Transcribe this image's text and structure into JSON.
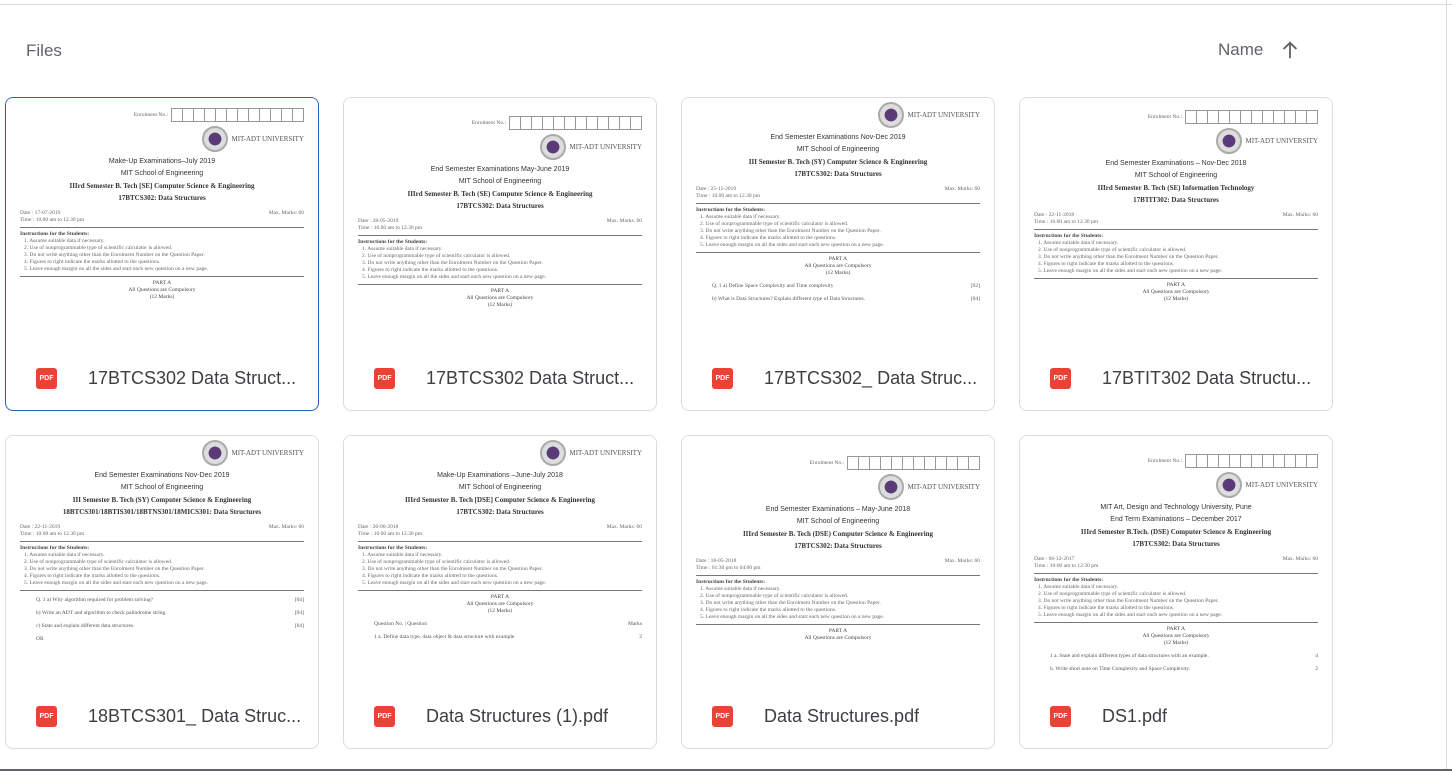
{
  "header": {
    "title": "Files",
    "sort_label": "Name",
    "sort_direction": "ascending"
  },
  "colors": {
    "pdf_icon": "#ea4335",
    "selected_border": "#2a62b8"
  },
  "instructions_title": "Instructions for the Students:",
  "instructions": [
    "1. Assume suitable data if necessary.",
    "2. Use of nonprogrammable type of scientific calculator is allowed.",
    "3. Do not write anything other than the Enrolment Number on the Question Paper.",
    "4. Figures to right indicate the marks allotted to the questions.",
    "5. Leave enough margin on all the sides and start each new question on a new page."
  ],
  "logo_text": "MIT-ADT UNIVERSITY",
  "enrolment_label": "Enrolment No.:",
  "files": [
    {
      "name": "17BTCS302 Data Structures",
      "display": "17BTCS302 Data Struct...",
      "icon": "PDF",
      "selected": true,
      "enrol": true,
      "headings": [
        "Make-Up Examinations–July 2019",
        "MIT School of Engineering",
        "IIIrd Semester B. Tech [SE] Computer Science & Engineering",
        "17BTCS302: Data Structures"
      ],
      "date": "Date : 17-07-2019",
      "time": "Time : 10.00 am to 12.30 pm",
      "marks": "Max. Marks: 60",
      "body": [
        "PART A",
        "All Questions are Compulsory",
        "(12 Marks)"
      ],
      "questions": []
    },
    {
      "name": "17BTCS302 Data Structures",
      "display": "17BTCS302 Data Struct...",
      "icon": "PDF",
      "selected": false,
      "enrol": true,
      "headings": [
        "End Semester Examinations May-June 2019",
        "MIT School of Engineering",
        "IIIrd Semester B. Tech (SE) Computer Science & Engineering",
        "17BTCS302: Data Structures"
      ],
      "date": "Date : 28-05-2019",
      "time": "Time : 10.00 am to 12.30 pm",
      "marks": "Max. Marks: 60",
      "body": [
        "PART A",
        "All Questions are Compulsory",
        "(12 Marks)"
      ],
      "questions": []
    },
    {
      "name": "17BTCS302_ Data Structures",
      "display": "17BTCS302_ Data Struc...",
      "icon": "PDF",
      "selected": false,
      "enrol": false,
      "headings": [
        "End Semester Examinations Nov-Dec 2019",
        "MIT School of Engineering",
        "III Semester B. Tech (SY) Computer Science & Engineering",
        "17BTCS302: Data Structures"
      ],
      "date": "Date : 25-11-2019",
      "time": "Time : 10.00 am to 12.30 pm",
      "marks": "Max. Marks: 60",
      "body": [
        "PART A",
        "All Questions are Compulsory",
        "(12 Marks)"
      ],
      "questions": [
        {
          "q": "Q. 1   a) Define Space Complexity and Time complexity",
          "m": "[02]"
        },
        {
          "q": "b) What is Data Structures? Explain different type of Data Structures.",
          "m": "[04]"
        }
      ]
    },
    {
      "name": "17BTIT302 Data Structures",
      "display": "17BTIT302 Data Structu...",
      "icon": "PDF",
      "selected": false,
      "enrol": true,
      "headings": [
        "End Semester Examinations – Nov-Dec 2018",
        "MIT School of Engineering",
        "IIIrd Semester B. Tech (SE) Information Technology",
        "17BTIT302: Data Structures"
      ],
      "date": "Date : 22-11-2018",
      "time": "Time : 10.00 am to 12.30 pm",
      "marks": "Max. Marks: 60",
      "body": [
        "PART A",
        "All Questions are Compulsory",
        "(12 Marks)"
      ],
      "questions": []
    },
    {
      "name": "18BTCS301_ Data Structures",
      "display": "18BTCS301_ Data Struc...",
      "icon": "PDF",
      "selected": false,
      "enrol": false,
      "headings": [
        "End Semester Examinations Nov-Dec 2019",
        "MIT School of Engineering",
        "III Semester B. Tech (SY) Computer Science & Engineering",
        "18BTCS301/18BTIS301/18BTNS301/18MICS301: Data Structures"
      ],
      "date": "Date : 22-11-2019",
      "time": "Time : 10:00 am to 12.30 pm",
      "marks": "Max. Marks: 60",
      "body": [],
      "questions": [
        {
          "q": "Q. 1   a) Why algorithm required for problem solving?",
          "m": "[04]"
        },
        {
          "q": "b) Write an ADT and algorithm to check palindrome string.",
          "m": "[04]"
        },
        {
          "q": "c) State and explain different data structures.",
          "m": "[04]"
        },
        {
          "q": "OR",
          "m": ""
        }
      ]
    },
    {
      "name": "Data Structures (1).pdf",
      "display": "Data Structures (1).pdf",
      "icon": "PDF",
      "selected": false,
      "enrol": false,
      "headings": [
        "Make-Up Examinations –June-July 2018",
        "MIT School of Engineering",
        "IIIrd Semester B. Tech [DSE] Computer Science & Engineering",
        "17BTCS302: Data Structures"
      ],
      "date": "Date : 26-06-2018",
      "time": "Time : 10.00 am to 12.30 pm",
      "marks": "Max. Marks: 60",
      "body": [
        "PART A",
        "All Questions are Compulsory",
        "(12 Marks)"
      ],
      "questions": [
        {
          "q": "Question No. | Question",
          "m": "Marks"
        },
        {
          "q": "1   a. Define data type, data object & data structure with example",
          "m": "2"
        }
      ]
    },
    {
      "name": "Data Structures.pdf",
      "display": "Data Structures.pdf",
      "icon": "PDF",
      "selected": false,
      "enrol": true,
      "headings": [
        "End Semester Examinations – May-June 2018",
        "MIT School of Engineering",
        "IIIrd Semester B. Tech (DSE) Computer Science & Engineering",
        "17BTCS302: Data Structures"
      ],
      "date": "Date : 18-05-2018",
      "time": "Time : 01:30 pm to 04:00 pm",
      "marks": "Max. Marks: 60",
      "body": [
        "PART A",
        "All Questions are Compulsory"
      ],
      "questions": []
    },
    {
      "name": "DS1.pdf",
      "display": "DS1.pdf",
      "icon": "PDF",
      "selected": false,
      "enrol": true,
      "headings": [
        "MIT Art, Design and Technology University, Pune",
        "End Term Examinations – December 2017",
        "IIIrd Semester B.Tech. (DSE) Computer Science & Engineering",
        "17BTCS302: Data Structures"
      ],
      "date": "Date : 06-12-2017",
      "time": "Time : 10:00 am to 12:30 pm",
      "marks": "Max. Marks: 60",
      "body": [
        "PART A",
        "All Questions are Compulsory",
        "(12 Marks)"
      ],
      "questions": [
        {
          "q": "1   a. State and explain different types of data structures with an example.",
          "m": "4"
        },
        {
          "q": "b. Write short note on Time Complexity and Space Complexity.",
          "m": "2"
        }
      ]
    }
  ]
}
